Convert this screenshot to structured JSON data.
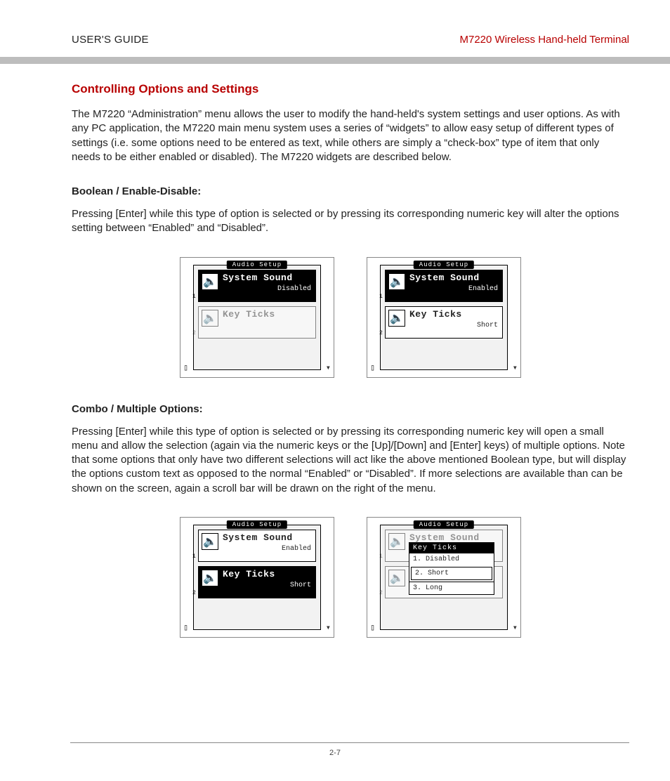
{
  "header": {
    "left": "USER'S GUIDE",
    "right": "M7220 Wireless Hand-held Terminal"
  },
  "section_title": "Controlling Options and Settings",
  "intro": "The M7220 “Administration” menu allows the user to modify the hand-held's system settings and user options.  As with any PC application, the M7220 main menu system uses a series of “widgets” to allow easy setup of different types of settings  (i.e. some options need to be entered as text, while others are simply a “check-box” type of item that only needs to be either enabled or disabled).  The M7220 widgets are described below.",
  "bool_heading": "Boolean / Enable-Disable:",
  "bool_body": "Pressing [Enter] while this type of option is selected or by pressing its corresponding numeric key will alter the options setting between “Enabled” and “Disabled”.",
  "combo_heading": "Combo / Multiple Options:",
  "combo_body": "Pressing [Enter] while this type of option is selected or by pressing its corresponding numeric key will open a small menu and allow the selection (again via the numeric keys or the [Up]/[Down] and [Enter] keys) of multiple options.  Note that some options that only have two different selections will act like the above mentioned Boolean type, but will display the options custom text as opposed to the normal “Enabled” or “Disabled”.  If more selections are available than can be shown on the screen, again a scroll bar will be drawn on the right of the menu.",
  "lcd_title": "Audio Setup",
  "row1": {
    "num": "1",
    "label": "System Sound"
  },
  "row2": {
    "num": "2",
    "label": "Key Ticks"
  },
  "vals": {
    "disabled": "Disabled",
    "enabled": "Enabled",
    "short": "Short"
  },
  "popup": {
    "title": "Key Ticks",
    "items": [
      "1. Disabled",
      "2. Short",
      "3. Long"
    ]
  },
  "page_number": "2-7"
}
